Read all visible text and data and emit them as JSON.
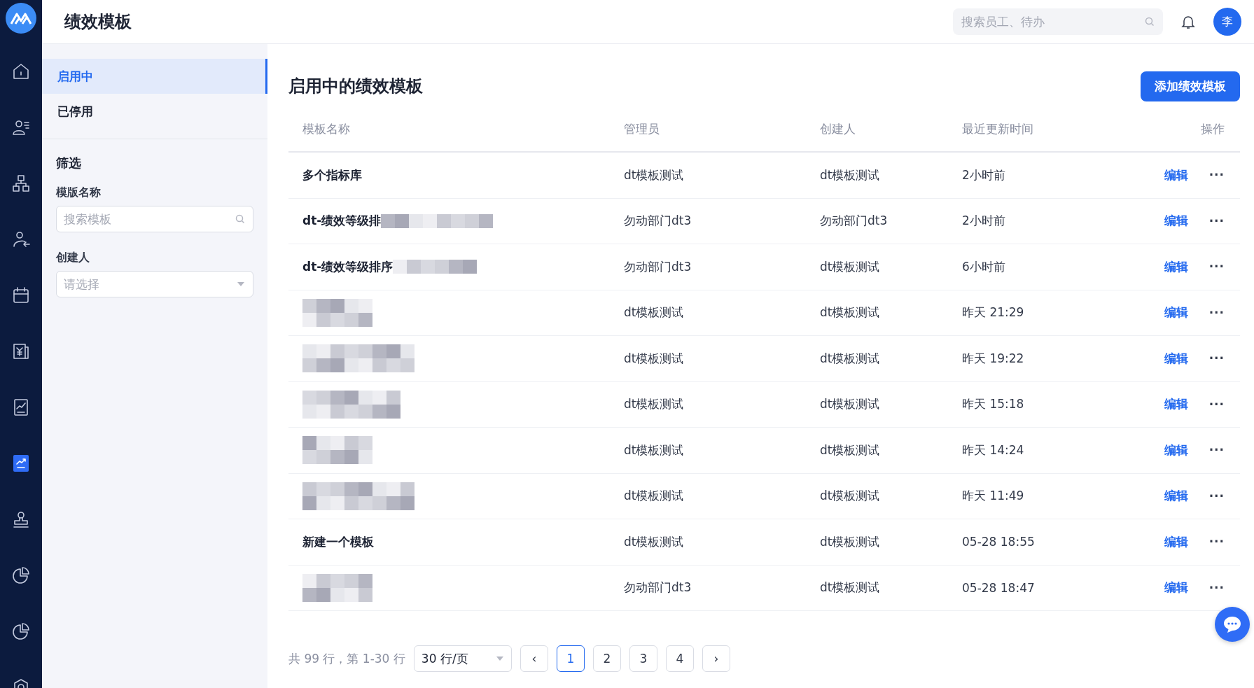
{
  "app": {
    "title": "绩效模板",
    "search": {
      "placeholder": "搜索员工、待办"
    },
    "avatar": "李"
  },
  "rail": [
    {
      "kind": "home",
      "selected": false
    },
    {
      "kind": "people",
      "selected": false
    },
    {
      "kind": "org",
      "selected": false
    },
    {
      "kind": "transfer",
      "selected": false
    },
    {
      "kind": "calendar",
      "selected": false
    },
    {
      "kind": "salary",
      "selected": false
    },
    {
      "kind": "report",
      "selected": false
    },
    {
      "kind": "performance",
      "selected": true
    },
    {
      "kind": "stamp",
      "selected": false
    },
    {
      "kind": "pie",
      "selected": false
    },
    {
      "kind": "pie",
      "selected": false
    },
    {
      "kind": "gear",
      "selected": false
    }
  ],
  "sidebar": {
    "items": [
      {
        "label": "启用中",
        "selected": true
      },
      {
        "label": "已停用",
        "selected": false
      }
    ],
    "filter_title": "筛选",
    "filters": [
      {
        "label": "模版名称",
        "kind": "search",
        "placeholder": "搜索模板"
      },
      {
        "label": "创建人",
        "kind": "select",
        "placeholder": "请选择"
      }
    ]
  },
  "main": {
    "title": "启用中的绩效模板",
    "add_button": "添加绩效模板",
    "columns": [
      "模板名称",
      "管理员",
      "创建人",
      "最近更新时间",
      "操作"
    ],
    "rows": [
      {
        "kind": "text",
        "name": "多个指标库",
        "admin": "dt模板测试",
        "creator": "dt模板测试",
        "updated": "2小时前",
        "action": "编辑",
        "more": "···"
      },
      {
        "kind": "partial",
        "name": "dt-绩效等级排",
        "admin": "勿动部门dt3",
        "creator": "勿动部门dt3",
        "updated": "2小时前",
        "action": "编辑",
        "more": "···"
      },
      {
        "kind": "partial",
        "name": "dt-绩效等级排序",
        "admin": "勿动部门dt3",
        "creator": "dt模板测试",
        "updated": "6小时前",
        "action": "编辑",
        "more": "···"
      },
      {
        "kind": "redacted",
        "admin": "dt模板测试",
        "creator": "dt模板测试",
        "updated": "昨天 21:29",
        "action": "编辑",
        "more": "···"
      },
      {
        "kind": "redacted",
        "admin": "dt模板测试",
        "creator": "dt模板测试",
        "updated": "昨天 19:22",
        "action": "编辑",
        "more": "···"
      },
      {
        "kind": "redacted",
        "admin": "dt模板测试",
        "creator": "dt模板测试",
        "updated": "昨天 15:18",
        "action": "编辑",
        "more": "···"
      },
      {
        "kind": "redacted",
        "admin": "dt模板测试",
        "creator": "dt模板测试",
        "updated": "昨天 14:24",
        "action": "编辑",
        "more": "···"
      },
      {
        "kind": "redacted",
        "admin": "dt模板测试",
        "creator": "dt模板测试",
        "updated": "昨天 11:49",
        "action": "编辑",
        "more": "···"
      },
      {
        "kind": "text",
        "name": "新建一个模板",
        "admin": "dt模板测试",
        "creator": "dt模板测试",
        "updated": "05-28 18:55",
        "action": "编辑",
        "more": "···"
      },
      {
        "kind": "redacted",
        "admin": "勿动部门dt3",
        "creator": "dt模板测试",
        "updated": "05-28 18:47",
        "action": "编辑",
        "more": "···"
      }
    ],
    "pagination": {
      "summary": "共 99 行，第 1-30 行",
      "page_size": "30 行/页",
      "prev": "‹",
      "next": "›",
      "pages": [
        {
          "label": "1",
          "selected": true
        },
        {
          "label": "2",
          "selected": false
        },
        {
          "label": "3",
          "selected": false
        },
        {
          "label": "4",
          "selected": false
        }
      ]
    }
  }
}
